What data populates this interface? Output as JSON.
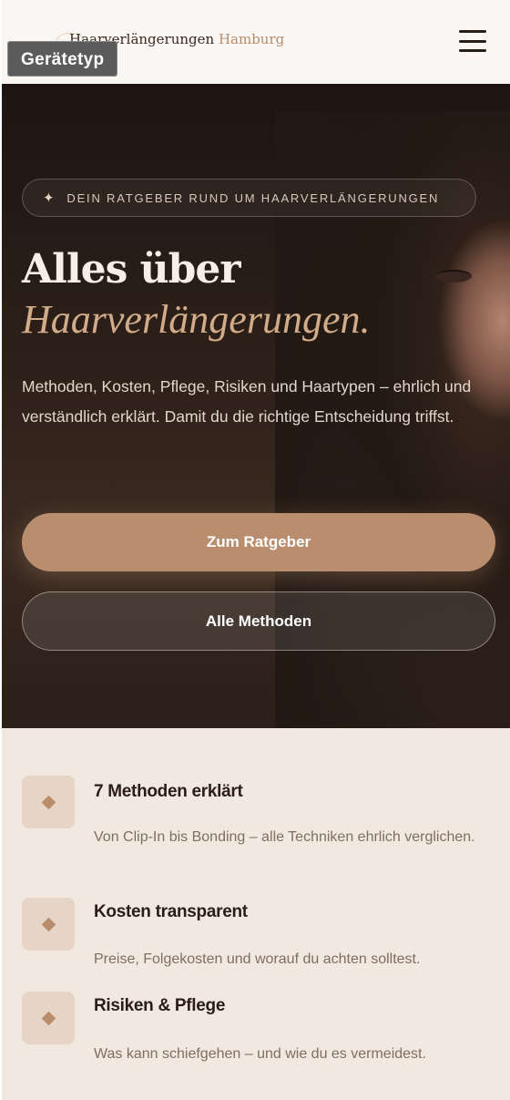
{
  "header": {
    "brand_main": "Haarverlängerungen",
    "brand_accent": "Hamburg",
    "menu_icon": "hamburger-icon"
  },
  "overlay": {
    "device_type_label": "Gerätetyp"
  },
  "hero": {
    "badge_icon": "sparkle-icon",
    "badge_text": "DEIN RATGEBER RUND UM HAARVERLÄNGERUNGEN",
    "title_line1": "Alles über",
    "title_line2": "Haarverlängerungen.",
    "lead": "Methoden, Kosten, Pflege, Risiken und Haartypen – ehrlich und verständlich erklärt. Damit du die richtige Entscheidung triffst.",
    "primary_button": "Zum Ratgeber",
    "secondary_button": "Alle Methoden"
  },
  "features": [
    {
      "icon": "diamond-icon",
      "title": "7 Methoden erklärt",
      "text": "Von Clip-In bis Bonding – alle Techniken ehrlich verglichen."
    },
    {
      "icon": "diamond-icon",
      "title": "Kosten transparent",
      "text": "Preise, Folgekosten und worauf du achten solltest."
    },
    {
      "icon": "diamond-icon",
      "title": "Risiken & Pflege",
      "text": "Was kann schiefgehen – und wie du es vermeidest."
    }
  ],
  "colors": {
    "accent": "#b98e6e",
    "hero_bg": "#2c1f18",
    "page_bg": "#f1e8e0"
  }
}
